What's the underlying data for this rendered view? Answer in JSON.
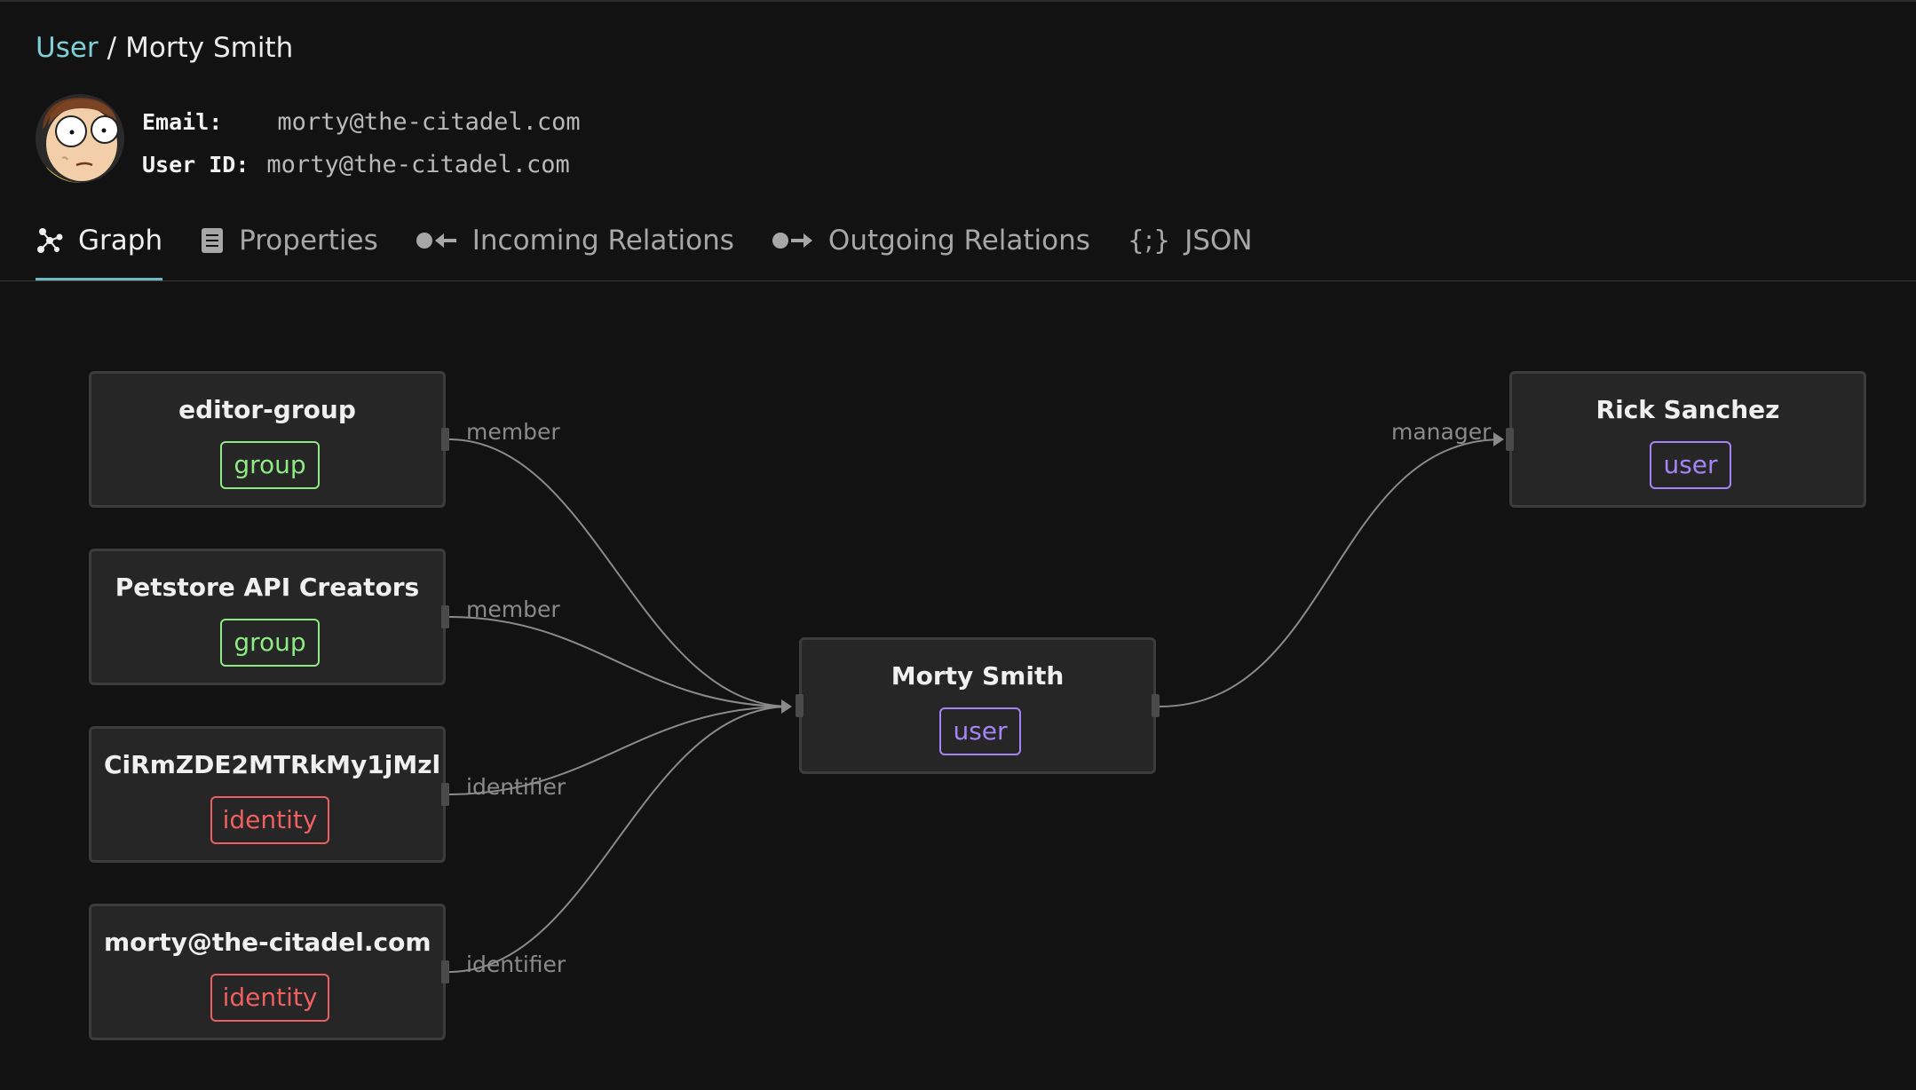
{
  "breadcrumb": {
    "parent": "User",
    "separator": "/",
    "current": "Morty Smith"
  },
  "profile": {
    "email_label": "Email:",
    "email_value": "morty@the-citadel.com",
    "userid_label": "User ID:",
    "userid_value": "morty@the-citadel.com"
  },
  "tabs": [
    {
      "label": "Graph",
      "icon": "graph-icon",
      "active": true
    },
    {
      "label": "Properties",
      "icon": "document-icon",
      "active": false
    },
    {
      "label": "Incoming Relations",
      "icon": "incoming-arrow-icon",
      "active": false
    },
    {
      "label": "Outgoing Relations",
      "icon": "outgoing-arrow-icon",
      "active": false
    },
    {
      "label": "JSON",
      "icon": "braces-icon",
      "active": false
    }
  ],
  "colors": {
    "group": "#8eea82",
    "user": "#a585f5",
    "identity": "#ee5f5f",
    "accent": "#7fcfd6"
  },
  "graph": {
    "nodes": {
      "editor_group": {
        "title": "editor-group",
        "type": "group"
      },
      "petstore": {
        "title": "Petstore API Creators",
        "type": "group"
      },
      "identity1": {
        "title": "CiRmZDE2MTRkMy1jMzl...",
        "type": "identity"
      },
      "identity2": {
        "title": "morty@the-citadel.com",
        "type": "identity"
      },
      "morty": {
        "title": "Morty Smith",
        "type": "user"
      },
      "rick": {
        "title": "Rick Sanchez",
        "type": "user"
      }
    },
    "edges": [
      {
        "from": "editor_group",
        "to": "morty",
        "label": "member"
      },
      {
        "from": "petstore",
        "to": "morty",
        "label": "member"
      },
      {
        "from": "identity1",
        "to": "morty",
        "label": "identifier"
      },
      {
        "from": "identity2",
        "to": "morty",
        "label": "identifier"
      },
      {
        "from": "morty",
        "to": "rick",
        "label": "manager"
      }
    ]
  }
}
